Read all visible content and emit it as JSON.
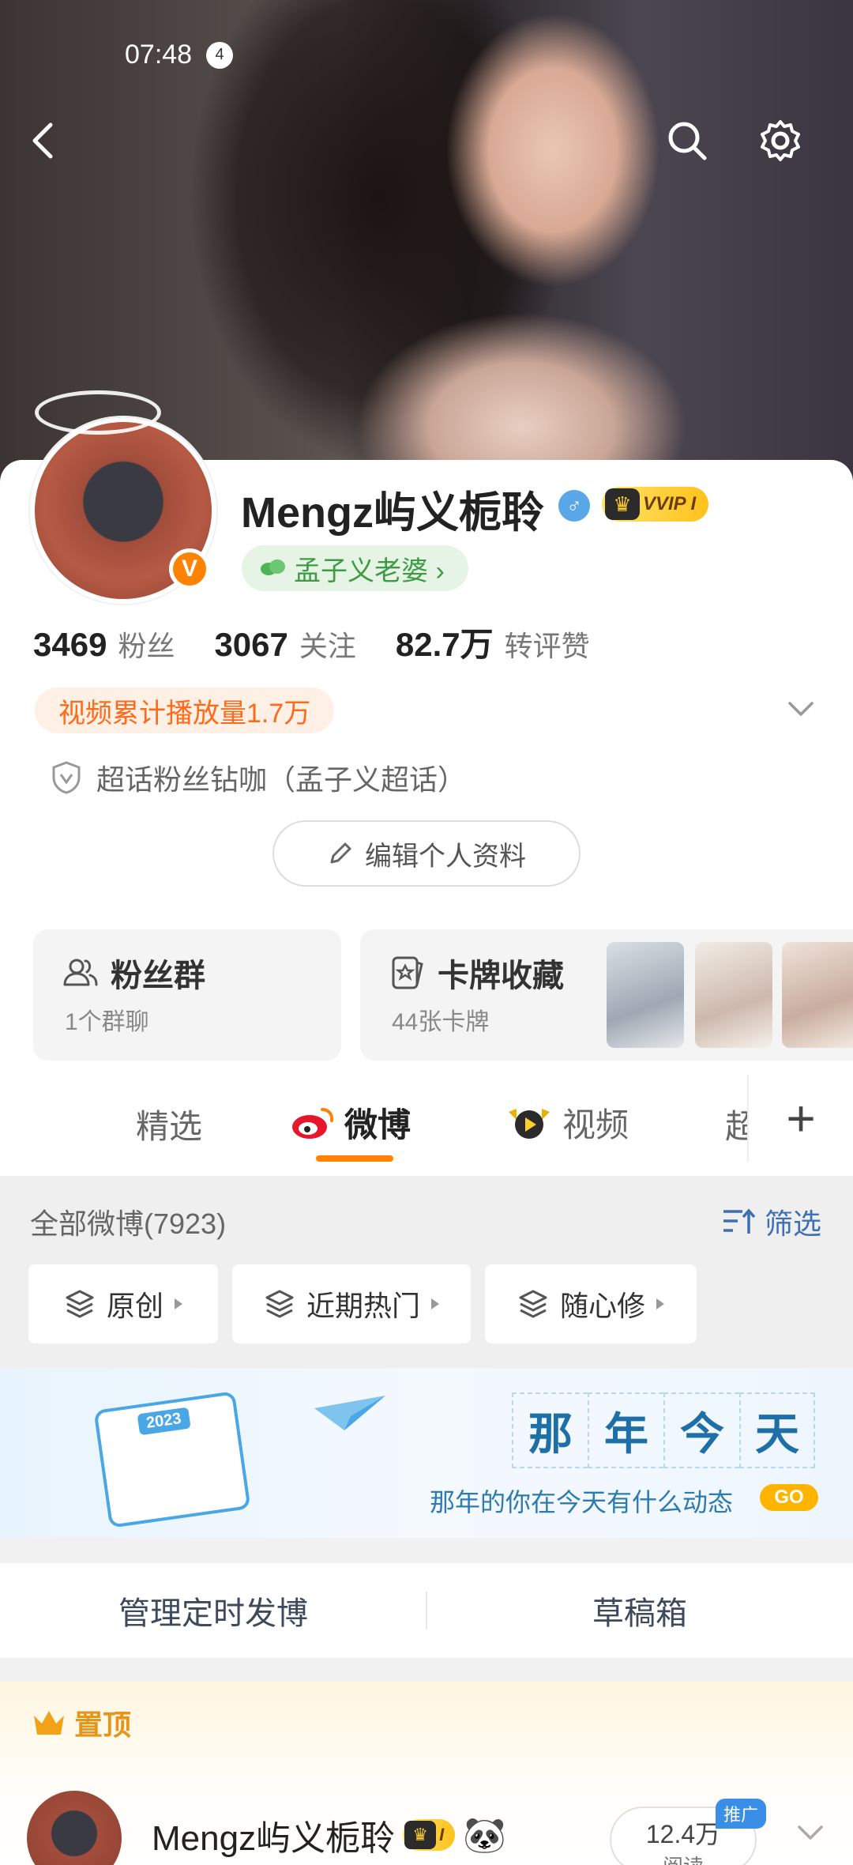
{
  "status": {
    "time": "07:48",
    "notif_count": "4"
  },
  "profile": {
    "username": "Mengz屿义栀聆",
    "gender_symbol": "♂",
    "vip_label": "VVIP I",
    "fan_tag": "孟子义老婆 ›",
    "stats": [
      {
        "num": "3469",
        "label": "粉丝"
      },
      {
        "num": "3067",
        "label": "关注"
      },
      {
        "num": "82.7万",
        "label": "转评赞"
      }
    ],
    "play_count": "视频累计播放量1.7万",
    "super_topic": "超话粉丝钻咖（孟子义超话）",
    "edit_label": "编辑个人资料"
  },
  "cards": {
    "fan_group": {
      "title": "粉丝群",
      "sub": "1个群聊"
    },
    "card_collect": {
      "title": "卡牌收藏",
      "sub": "44张卡牌"
    }
  },
  "tabs": [
    {
      "label": "精选"
    },
    {
      "label": "微博"
    },
    {
      "label": "视频"
    },
    {
      "label": "超"
    }
  ],
  "feed": {
    "all_count": "全部微博(7923)",
    "filter_label": "筛选",
    "chips": [
      "原创",
      "近期热门",
      "随心修"
    ]
  },
  "banner": {
    "year": "2023",
    "chars": [
      "那",
      "年",
      "今",
      "天"
    ],
    "subtitle": "那年的你在今天有什么动态",
    "go": "GO"
  },
  "manage": {
    "scheduled": "管理定时发博",
    "drafts": "草稿箱"
  },
  "pinned": {
    "label": "置顶",
    "post_name": "Mengz屿义栀聆",
    "vip_label": "I",
    "emoji": "🐼",
    "reads_num": "12.4万",
    "reads_label": "阅读",
    "promo": "推广"
  },
  "colors": {
    "accent": "#ff8200",
    "link": "#3e6fb5",
    "green_tag": "#3f9a45"
  }
}
